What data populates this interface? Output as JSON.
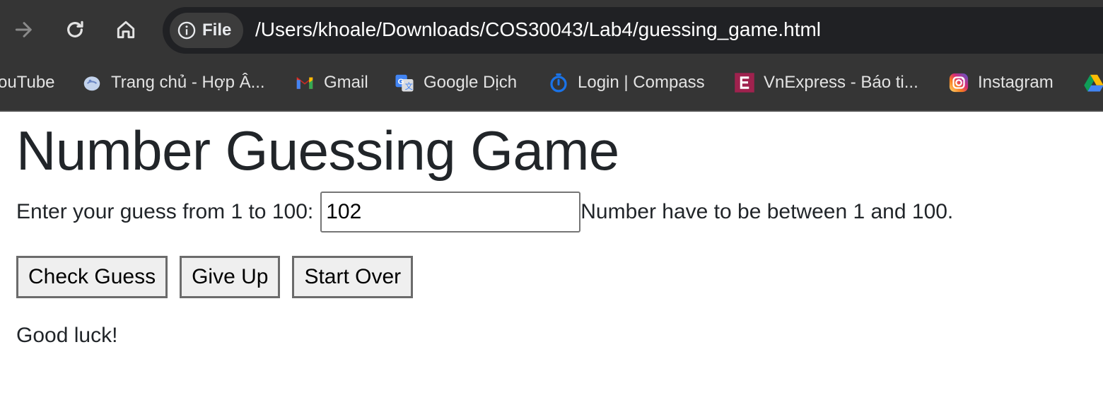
{
  "browser": {
    "site_chip_label": "File",
    "url": "/Users/khoale/Downloads/COS30043/Lab4/guessing_game.html",
    "bookmarks": [
      {
        "label": "ouTube",
        "icon": "youtube-icon"
      },
      {
        "label": "Trang chủ - Hợp Â...",
        "icon": "globe-icon"
      },
      {
        "label": "Gmail",
        "icon": "gmail-icon"
      },
      {
        "label": "Google Dịch",
        "icon": "google-translate-icon"
      },
      {
        "label": "Login | Compass",
        "icon": "compass-icon"
      },
      {
        "label": "VnExpress - Báo ti...",
        "icon": "vnexpress-icon"
      },
      {
        "label": "Instagram",
        "icon": "instagram-icon"
      },
      {
        "label": "",
        "icon": "google-drive-icon"
      }
    ]
  },
  "game": {
    "title": "Number Guessing Game",
    "guess_label": "Enter your guess from 1 to 100:",
    "guess_value": "102",
    "validation_message": "Number have to be between 1 and 100.",
    "buttons": {
      "check": "Check Guess",
      "give_up": "Give Up",
      "start_over": "Start Over"
    },
    "status_message": "Good luck!"
  },
  "colors": {
    "chrome_background": "#353535",
    "omnibox_background": "#202124",
    "page_text": "#212529",
    "button_background": "#efefef"
  }
}
